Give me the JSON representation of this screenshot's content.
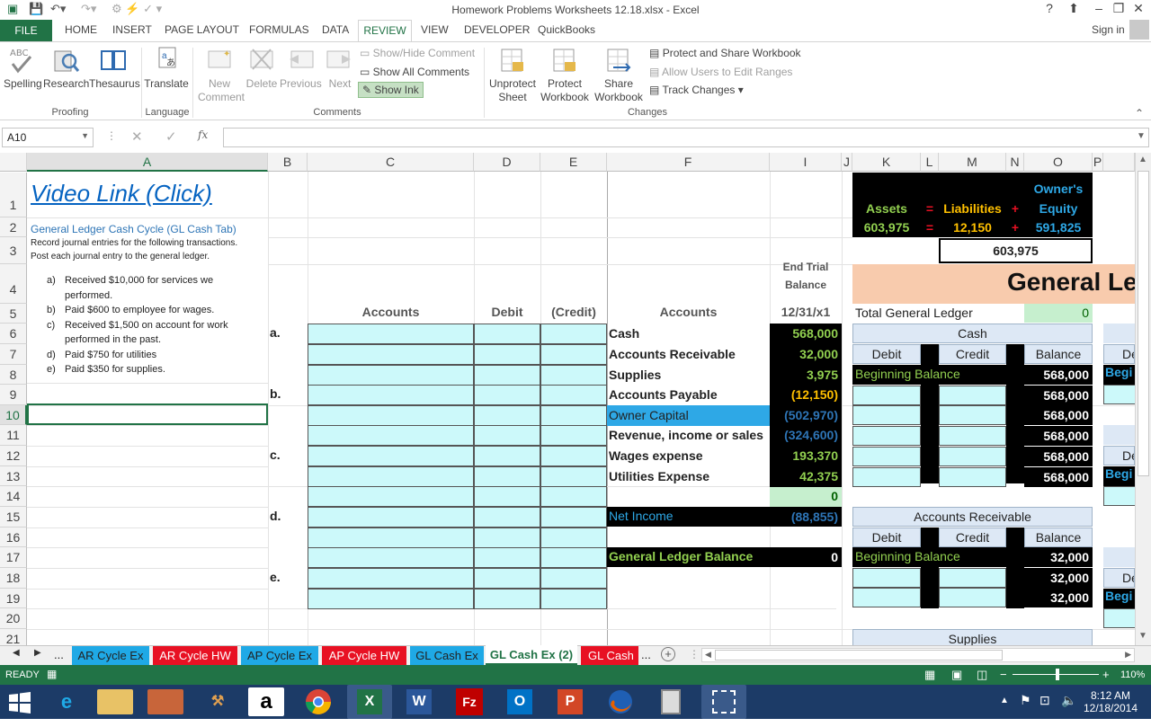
{
  "window": {
    "title": "Homework Problems Worksheets 12.18.xlsx - Excel",
    "help": "?",
    "sign_in": "Sign in"
  },
  "ribbon_tabs": [
    "FILE",
    "HOME",
    "INSERT",
    "PAGE LAYOUT",
    "FORMULAS",
    "DATA",
    "REVIEW",
    "VIEW",
    "DEVELOPER",
    "QuickBooks"
  ],
  "ribbon": {
    "spelling": "Spelling",
    "research": "Research",
    "thesaurus": "Thesaurus",
    "translate": "Translate",
    "new_comment_1": "New",
    "new_comment_2": "Comment",
    "delete": "Delete",
    "previous": "Previous",
    "next": "Next",
    "show_hide_comment": "Show/Hide Comment",
    "show_all_comments": "Show All Comments",
    "show_ink": "Show Ink",
    "unprotect_1": "Unprotect",
    "unprotect_2": "Sheet",
    "protect_wb_1": "Protect",
    "protect_wb_2": "Workbook",
    "share_wb_1": "Share",
    "share_wb_2": "Workbook",
    "protect_share": "Protect and Share Workbook",
    "allow_users": "Allow Users to Edit Ranges",
    "track_changes": "Track Changes",
    "group_proofing": "Proofing",
    "group_language": "Language",
    "group_comments": "Comments",
    "group_changes": "Changes"
  },
  "formula_bar": {
    "name_box": "A10",
    "fx": "fx",
    "content": ""
  },
  "columns": [
    "A",
    "B",
    "C",
    "D",
    "E",
    "F",
    "I",
    "J",
    "K",
    "L",
    "M",
    "N",
    "O",
    "P"
  ],
  "rows": [
    "1",
    "2",
    "3",
    "4",
    "5",
    "6",
    "7",
    "8",
    "9",
    "10",
    "11",
    "12",
    "13",
    "14",
    "15",
    "16",
    "17",
    "18",
    "19",
    "20",
    "21"
  ],
  "sheet": {
    "video_link": "Video Link (Click)",
    "gl_cycle": "General Ledger Cash Cycle (GL Cash Tab)",
    "instr1": "Record journal entries for the following transactions.",
    "instr2": "Post each journal entry to the general ledger.",
    "transactions": [
      {
        "letter": "a)",
        "line1": "Received $10,000 for services we",
        "line2": "performed."
      },
      {
        "letter": "b)",
        "line1": "Paid $600 to employee for wages.",
        "line2": ""
      },
      {
        "letter": "c)",
        "line1": "Received $1,500 on account for work",
        "line2": "performed in the past."
      },
      {
        "letter": "d)",
        "line1": "Paid $750 for utilities",
        "line2": ""
      },
      {
        "letter": "e)",
        "line1": "Paid $350 for supplies.",
        "line2": ""
      }
    ],
    "journal_headers": {
      "accounts": "Accounts",
      "debit": "Debit",
      "credit": "(Credit)"
    },
    "entry_letters": [
      "a.",
      "b.",
      "c.",
      "d.",
      "e."
    ],
    "trial_balance": {
      "header1": "End Trial",
      "header2": "Balance",
      "date": "12/31/x1",
      "accounts_label": "Accounts",
      "rows": [
        {
          "account": "Cash",
          "value": "568,000"
        },
        {
          "account": "Accounts Receivable",
          "value": "32,000"
        },
        {
          "account": "Supplies",
          "value": "3,975"
        },
        {
          "account": "Accounts Payable",
          "value": "(12,150)"
        },
        {
          "account": "Owner Capital",
          "value": "(502,970)"
        },
        {
          "account": "Revenue, income or sales",
          "value": "(324,600)"
        },
        {
          "account": "Wages expense",
          "value": "193,370"
        },
        {
          "account": "Utilities Expense",
          "value": "42,375"
        }
      ],
      "total": "0",
      "net_income_label": "Net Income",
      "net_income": "(88,855)",
      "gl_balance_label": "General Ledger Balance",
      "gl_balance": "0"
    },
    "equation": {
      "assets_label": "Assets",
      "eq": "=",
      "liabilities_label": "Liabilities",
      "plus": "+",
      "owners_1": "Owner's",
      "owners_2": "Equity",
      "assets": "603,975",
      "liabilities": "12,150",
      "equity": "591,825",
      "check": "603,975"
    },
    "general_ledger": {
      "title": "General Le",
      "total_label": "Total General Ledger",
      "total_value": "0",
      "debit": "Debit",
      "credit": "Credit",
      "balance": "Balance",
      "beginning": "Beginning Balance",
      "cash_title": "Cash",
      "cash_balances": [
        "568,000",
        "568,000",
        "568,000",
        "568,000",
        "568,000",
        "568,000"
      ],
      "ar_title": "Accounts Receivable",
      "ar_balances": [
        "32,000",
        "32,000",
        "32,000"
      ],
      "supplies_title": "Supplies",
      "clip_de": "De",
      "clip_begi": "Begi"
    }
  },
  "sheet_tabs": [
    {
      "label": "AR Cycle Ex",
      "color": "#1fa9e6"
    },
    {
      "label": "AR Cycle HW",
      "color": "#e81123"
    },
    {
      "label": "AP Cycle Ex",
      "color": "#1fa9e6"
    },
    {
      "label": "AP Cycle HW",
      "color": "#e81123"
    },
    {
      "label": "GL Cash Ex",
      "color": "#1fa9e6"
    },
    {
      "label": "GL Cash Ex (2)",
      "color": "#ffffff"
    },
    {
      "label": "GL Cash H",
      "color": "#e81123"
    }
  ],
  "sheet_nav": {
    "ellipsis": "...",
    "ellipsis_right": "...",
    "add": "+"
  },
  "status": {
    "ready": "READY",
    "zoom": "110%"
  },
  "taskbar": {
    "time": "8:12 AM",
    "date": "12/18/2014",
    "apps": [
      "start-icon",
      "ie-icon",
      "explorer-icon",
      "paint-icon",
      "tool-icon",
      "amazon-icon",
      "chrome-icon",
      "excel-icon",
      "word-icon",
      "filezilla-icon",
      "outlook-icon",
      "powerpoint-icon",
      "firefox-icon",
      "calculator-icon",
      "snipping-icon"
    ],
    "labels": {
      "amazon": "a",
      "excel": "X",
      "word": "W",
      "filezilla": "Fz",
      "outlook": "O",
      "powerpoint": "P"
    }
  },
  "colors": {
    "excel_green": "#217346",
    "cyan": "#ccf9fa",
    "peach": "#f8cbad",
    "light_green": "#c6efce",
    "header_blue": "#dde8f5",
    "taskbar": "#1c3b67"
  }
}
